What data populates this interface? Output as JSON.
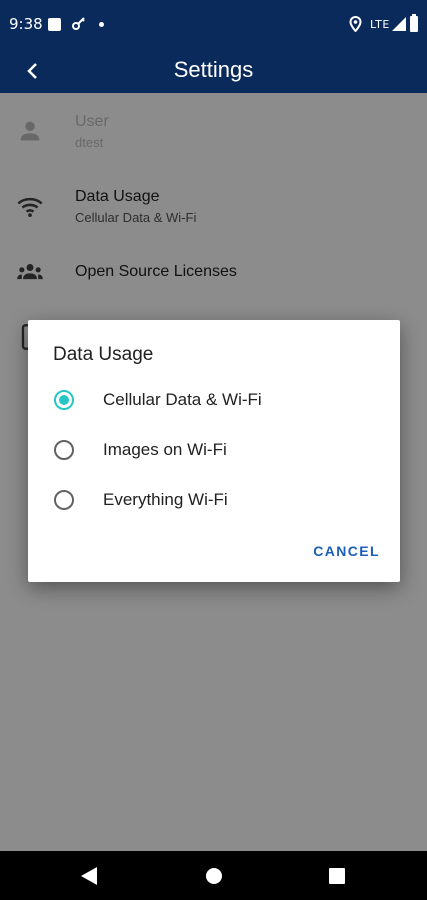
{
  "status_bar": {
    "time": "9:38",
    "network": "LTE",
    "icons": [
      "notification-square-icon",
      "key-icon",
      "dot-icon",
      "location-icon",
      "signal-icon",
      "battery-icon"
    ]
  },
  "app_bar": {
    "title": "Settings",
    "back_icon": "chevron-left-icon"
  },
  "settings": {
    "items": [
      {
        "title": "User",
        "subtitle": "dtest",
        "icon": "person-icon",
        "enabled": false
      },
      {
        "title": "Data Usage",
        "subtitle": "Cellular Data & Wi-Fi",
        "icon": "wifi-icon",
        "enabled": true
      },
      {
        "title": "Open Source Licenses",
        "subtitle": "",
        "icon": "group-icon",
        "enabled": true
      }
    ]
  },
  "dialog": {
    "title": "Data Usage",
    "options": [
      {
        "label": "Cellular Data & Wi-Fi",
        "selected": true
      },
      {
        "label": "Images on Wi-Fi",
        "selected": false
      },
      {
        "label": "Everything Wi-Fi",
        "selected": false
      }
    ],
    "cancel_label": "CANCEL"
  },
  "colors": {
    "primary_dark": "#0b2a5c",
    "accent": "#26c6c6",
    "button_text": "#1c5fb8"
  },
  "nav_bar": {
    "icons": [
      "back-triangle-icon",
      "home-circle-icon",
      "recents-square-icon"
    ]
  }
}
